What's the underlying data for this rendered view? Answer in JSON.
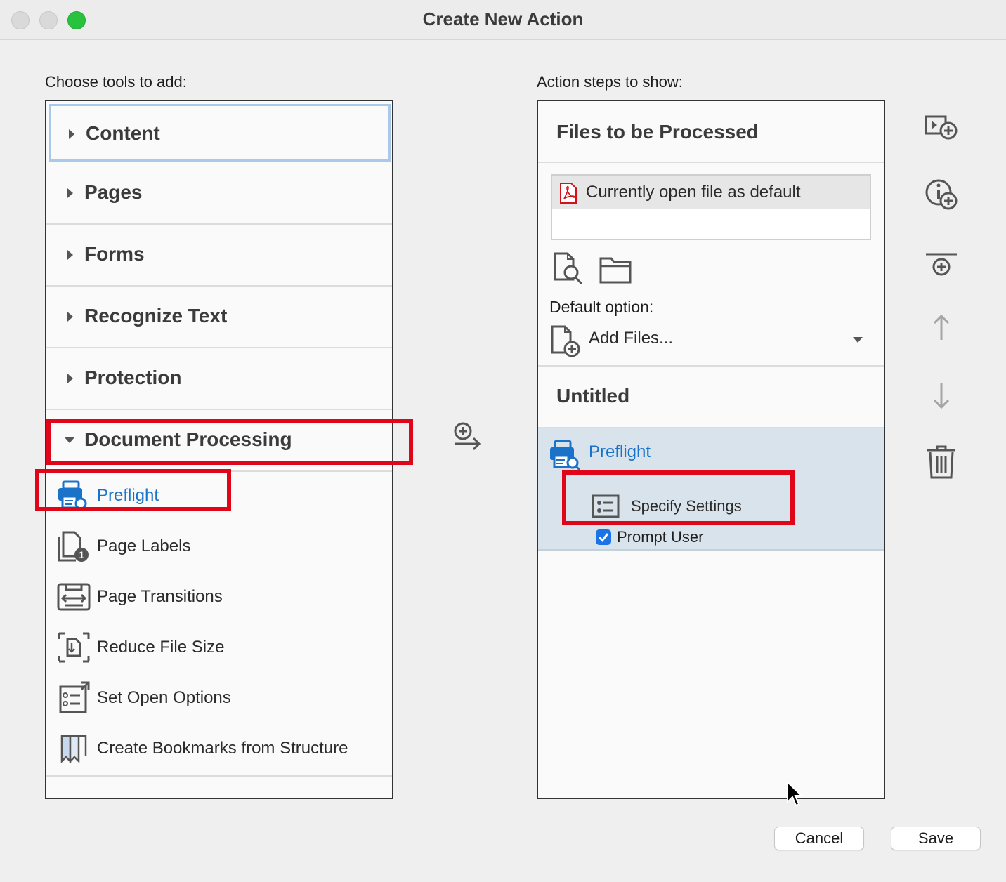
{
  "window": {
    "title": "Create New Action"
  },
  "left": {
    "label": "Choose tools to add:",
    "categories": [
      {
        "label": "Content"
      },
      {
        "label": "Pages"
      },
      {
        "label": "Forms"
      },
      {
        "label": "Recognize Text"
      },
      {
        "label": "Protection"
      },
      {
        "label": "Document Processing"
      }
    ],
    "tools": [
      {
        "label": "Preflight",
        "icon": "preflight-icon"
      },
      {
        "label": "Page Labels",
        "icon": "page-labels-icon"
      },
      {
        "label": "Page Transitions",
        "icon": "page-transitions-icon"
      },
      {
        "label": "Reduce File Size",
        "icon": "reduce-file-size-icon"
      },
      {
        "label": "Set Open Options",
        "icon": "set-open-options-icon"
      },
      {
        "label": "Create Bookmarks from Structure",
        "icon": "bookmarks-icon"
      }
    ]
  },
  "right": {
    "label": "Action steps to show:",
    "files_title": "Files to be Processed",
    "file_item": "Currently open file as default",
    "default_option_label": "Default option:",
    "default_option_value": "Add Files...",
    "section_title": "Untitled",
    "step": {
      "label": "Preflight",
      "setting": "Specify Settings",
      "prompt_label": "Prompt User",
      "prompt_checked": true
    }
  },
  "buttons": {
    "cancel": "Cancel",
    "save": "Save"
  },
  "colors": {
    "accent": "#1a73c9",
    "highlight": "#e0061a",
    "selected_row": "#d9e3ec"
  }
}
